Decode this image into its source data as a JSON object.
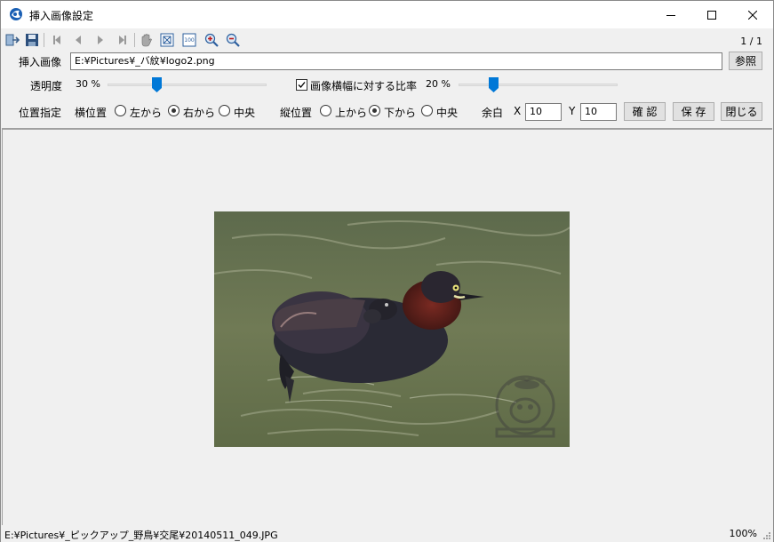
{
  "window": {
    "title": "挿入画像設定",
    "minimize_icon": "minimize-icon",
    "maximize_icon": "maximize-icon",
    "close_icon": "close-icon"
  },
  "toolbar": {
    "icons": [
      "exit-icon",
      "save-icon",
      "first-page-icon",
      "prev-page-icon",
      "next-page-icon",
      "last-page-icon",
      "hand-icon",
      "fit-icon",
      "actual-size-icon",
      "zoom-in-icon",
      "zoom-out-icon"
    ],
    "page_count": "1 / 1"
  },
  "insert_image": {
    "label": "挿入画像",
    "path": "E:¥Pictures¥_バ紋¥logo2.png",
    "browse_label": "参照"
  },
  "opacity": {
    "label": "透明度",
    "value_text": "30 %",
    "value": 30
  },
  "width_ratio": {
    "checkbox_label": "画像横幅に対する比率",
    "checked": true,
    "value_text": "20 %",
    "value": 20
  },
  "position": {
    "label": "位置指定",
    "horizontal_label": "横位置",
    "horizontal_options": [
      {
        "label": "左から",
        "selected": false
      },
      {
        "label": "右から",
        "selected": true
      },
      {
        "label": "中央",
        "selected": false
      }
    ],
    "vertical_label": "縦位置",
    "vertical_options": [
      {
        "label": "上から",
        "selected": false
      },
      {
        "label": "下から",
        "selected": true
      },
      {
        "label": "中央",
        "selected": false
      }
    ],
    "margin_label": "余白",
    "x_label": "X",
    "x_value": "10",
    "y_label": "Y",
    "y_value": "10"
  },
  "buttons": {
    "confirm": "確 認",
    "save": "保 存",
    "close": "閉じる"
  },
  "statusbar": {
    "path": "E:¥Pictures¥_ピックアップ_野鳥¥交尾¥20140511_049.JPG",
    "zoom": "100%"
  },
  "colors": {
    "accent": "#0078d7",
    "water": "#6b7452",
    "bird_body": "#2a2a35",
    "bird_neck": "#6a1f1c"
  }
}
